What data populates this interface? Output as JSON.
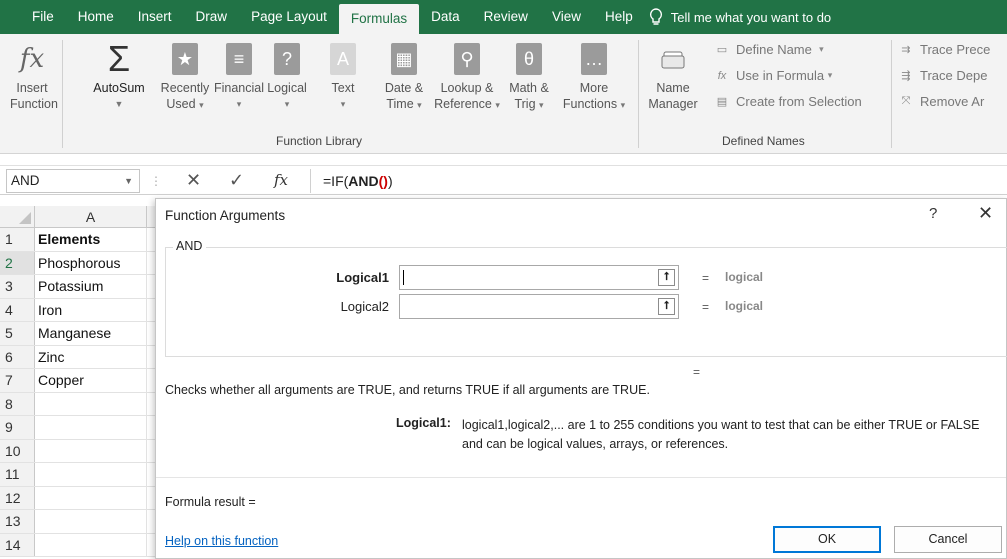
{
  "tabs": [
    "File",
    "Home",
    "Insert",
    "Draw",
    "Page Layout",
    "Formulas",
    "Data",
    "Review",
    "View",
    "Help"
  ],
  "active_tab": "Formulas",
  "tell_me": "Tell me what you want to do",
  "ribbon": {
    "insert_function": [
      "Insert",
      "Function"
    ],
    "autosum": "AutoSum",
    "recently_used": [
      "Recently",
      "Used"
    ],
    "financial": "Financial",
    "logical": "Logical",
    "text": "Text",
    "date_time": [
      "Date &",
      "Time"
    ],
    "lookup": [
      "Lookup &",
      "Reference"
    ],
    "math": [
      "Math &",
      "Trig"
    ],
    "more": [
      "More",
      "Functions"
    ],
    "function_library_label": "Function Library",
    "name_manager": [
      "Name",
      "Manager"
    ],
    "define_name": "Define Name",
    "use_in_formula": "Use in Formula",
    "create_from_selection": "Create from Selection",
    "defined_names_label": "Defined Names",
    "trace_precedents": "Trace Prece",
    "trace_dependents": "Trace Depe",
    "remove_arrows": "Remove Ar"
  },
  "formula_bar": {
    "name_box": "AND",
    "prefix": "=IF(",
    "func": "AND",
    "parens": "()",
    "suffix": ")"
  },
  "sheet": {
    "column": "A",
    "rows": [
      {
        "n": "1",
        "v": "Elements",
        "bold": true
      },
      {
        "n": "2",
        "v": "Phosphorous"
      },
      {
        "n": "3",
        "v": "Potassium"
      },
      {
        "n": "4",
        "v": "Iron"
      },
      {
        "n": "5",
        "v": "Manganese"
      },
      {
        "n": "6",
        "v": "Zinc"
      },
      {
        "n": "7",
        "v": "Copper"
      },
      {
        "n": "8",
        "v": ""
      },
      {
        "n": "9",
        "v": ""
      },
      {
        "n": "10",
        "v": ""
      },
      {
        "n": "11",
        "v": ""
      },
      {
        "n": "12",
        "v": ""
      },
      {
        "n": "13",
        "v": ""
      },
      {
        "n": "14",
        "v": ""
      }
    ]
  },
  "dialog": {
    "title": "Function Arguments",
    "help": "?",
    "close": "✕",
    "function_name": "AND",
    "arg1_label": "Logical1",
    "arg2_label": "Logical2",
    "equals": "=",
    "arg1_value": "logical",
    "arg2_value": "logical",
    "description": "Checks whether all arguments are TRUE, and returns TRUE if all arguments are TRUE.",
    "arg_desc_label": "Logical1:",
    "arg_desc": "logical1,logical2,... are 1 to 255 conditions you want to test that can be either TRUE or FALSE and can be logical values, arrays, or references.",
    "formula_result": "Formula result =",
    "help_link": "Help on this function",
    "ok": "OK",
    "cancel": "Cancel"
  }
}
